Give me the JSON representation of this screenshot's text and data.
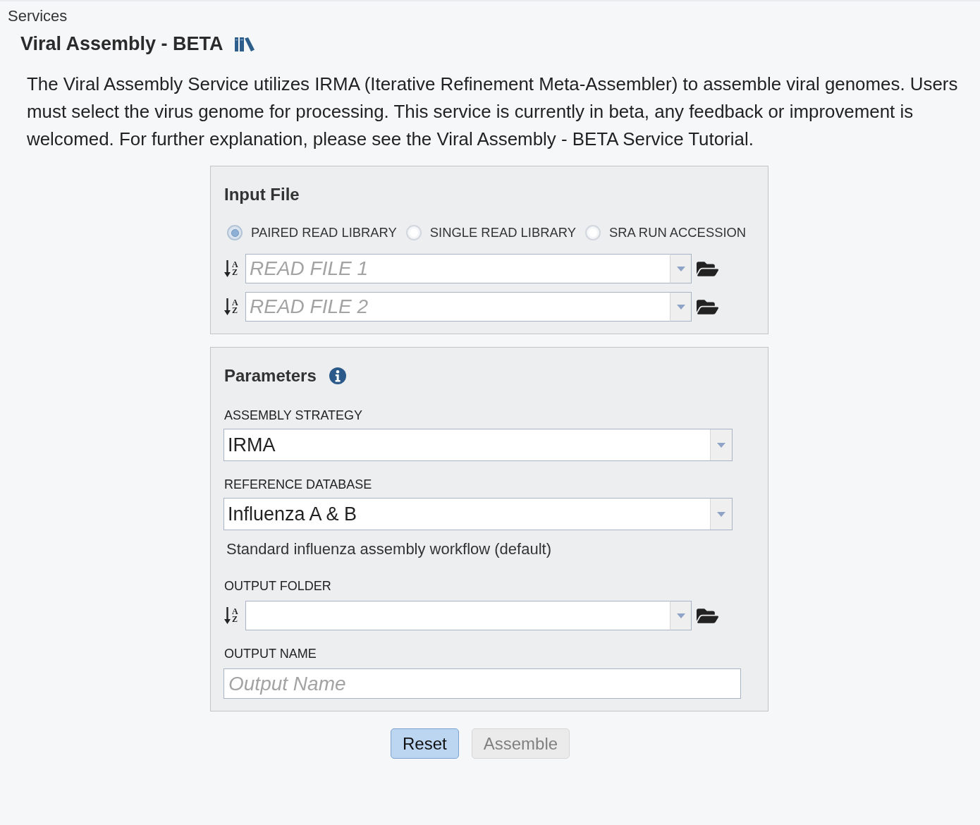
{
  "page": {
    "breadcrumb": "Services",
    "title": "Viral Assembly - BETA"
  },
  "description": "The Viral Assembly Service utilizes IRMA (Iterative Refinement Meta-Assembler) to assemble viral genomes. Users must select the virus genome for processing. This service is currently in beta, any feedback or improvement is welcomed. For further explanation, please see the Viral Assembly - BETA Service Tutorial.",
  "input_file": {
    "title": "Input File",
    "input_types": [
      {
        "label": "PAIRED READ LIBRARY",
        "selected": true
      },
      {
        "label": "SINGLE READ LIBRARY",
        "selected": false
      },
      {
        "label": "SRA RUN ACCESSION",
        "selected": false
      }
    ],
    "read_files": [
      {
        "sort_label": "AZ",
        "placeholder": "READ FILE 1"
      },
      {
        "sort_label": "AZ",
        "placeholder": "READ FILE 2"
      }
    ]
  },
  "parameters": {
    "title": "Parameters",
    "fields": [
      {
        "kind": "select",
        "label": "ASSEMBLY STRATEGY",
        "value": "IRMA"
      },
      {
        "kind": "select",
        "label": "REFERENCE DATABASE",
        "value": "Influenza A & B",
        "note": "Standard influenza assembly workflow (default)"
      },
      {
        "kind": "folder",
        "label": "OUTPUT FOLDER",
        "sort_label": "AZ"
      },
      {
        "kind": "text",
        "label": "OUTPUT NAME",
        "placeholder": "Output Name"
      }
    ]
  },
  "buttons": [
    {
      "label": "Reset",
      "disabled": false
    },
    {
      "label": "Assemble",
      "disabled": true
    }
  ]
}
